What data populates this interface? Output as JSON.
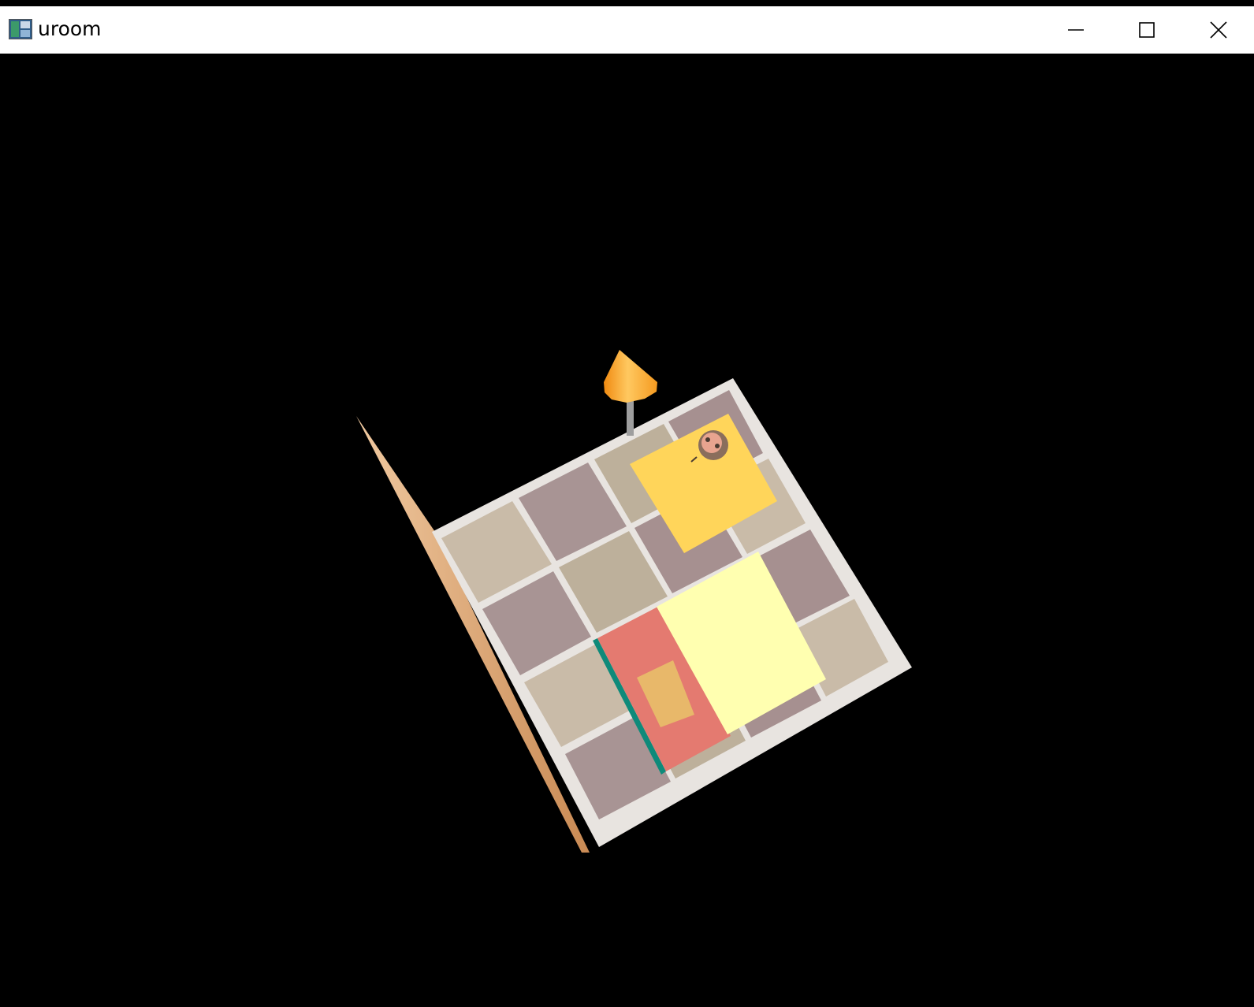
{
  "window": {
    "title": "uroom",
    "icon": "app-window-icon"
  },
  "controls": {
    "minimize_icon": "minimize-icon",
    "maximize_icon": "maximize-icon",
    "close_icon": "close-icon"
  },
  "colors": {
    "background": "#000000",
    "titlebar": "#ffffff",
    "cone": "#f5a623",
    "yellow_panel": "#ffd55a",
    "pale_panel": "#ffffb0",
    "salmon_panel": "#e47a70",
    "teal_edge": "#0e8a7a"
  }
}
